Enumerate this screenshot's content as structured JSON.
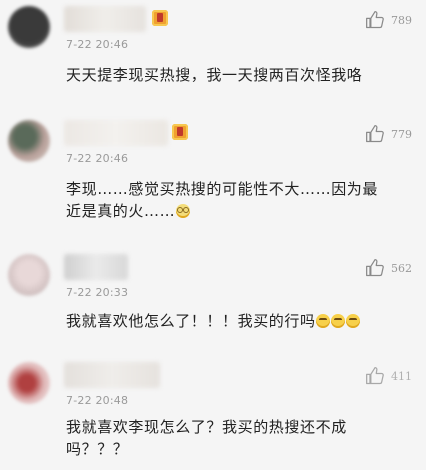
{
  "comments": [
    {
      "time": "7-22  20:46",
      "likes": "789",
      "text": "天天提李现买热搜，我一天搜两百次怪我咯",
      "has_badge": true
    },
    {
      "time": "7-22  20:46",
      "likes": "779",
      "text_line1": "李现……感觉买热搜的可能性不大……因为最",
      "text_line2": "近是真的火……",
      "emoji_icon": "glasses-face-emoji-icon",
      "has_badge": true
    },
    {
      "time": "7-22  20:33",
      "likes": "562",
      "text": "我就喜欢他怎么了！！！我买的行吗",
      "emoji_icons": [
        "grinning-emoji-icon",
        "grinning-emoji-icon",
        "grinning-emoji-icon"
      ],
      "has_badge": false
    },
    {
      "time": "7-22  20:48",
      "likes": "411",
      "text_line1": "我就喜欢李现怎么了？我买的热搜还不成",
      "text_line2": "吗？？？",
      "has_badge": false
    }
  ],
  "colors": {
    "background": "#f5f5f5",
    "time_text": "#9a9a9a",
    "like_icon": "#8a8a8a"
  }
}
